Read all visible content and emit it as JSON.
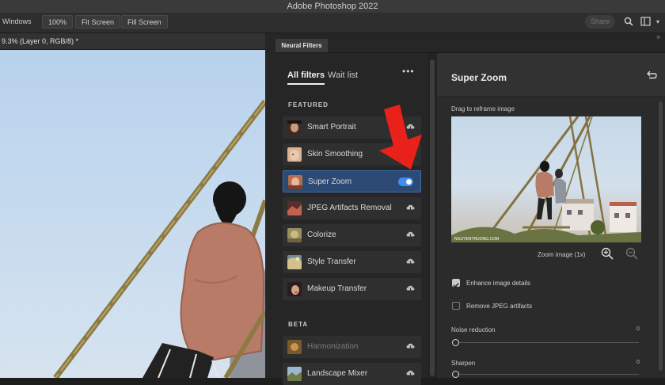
{
  "app": {
    "title": "Adobe Photoshop 2022"
  },
  "options_bar": {
    "windows_label": "Windows",
    "zoom_label": "100%",
    "fit_screen_label": "Fit Screen",
    "fill_screen_label": "Fill Screen",
    "share_label": "Share"
  },
  "document": {
    "tab_title": "9.3% (Layer 0, RGB/8) *"
  },
  "neural_filters": {
    "panel_tab": "Neural Filters",
    "tabs": {
      "all": "All filters",
      "wait": "Wait list"
    },
    "sections": {
      "featured": "FEATURED",
      "beta": "BETA"
    },
    "featured": [
      {
        "label": "Smart Portrait"
      },
      {
        "label": "Skin Smoothing"
      },
      {
        "label": "Super Zoom"
      },
      {
        "label": "JPEG Artifacts Removal"
      },
      {
        "label": "Colorize"
      },
      {
        "label": "Style Transfer"
      },
      {
        "label": "Makeup Transfer"
      }
    ],
    "beta": [
      {
        "label": "Harmonization"
      },
      {
        "label": "Landscape Mixer"
      }
    ],
    "selected_filter": "Super Zoom",
    "selected_enabled": true
  },
  "settings": {
    "title": "Super Zoom",
    "drag_hint": "Drag to reframe image",
    "zoom_label": "Zoom image (1x)",
    "enhance_label": "Enhance image details",
    "enhance_checked": true,
    "remove_jpeg_label": "Remove JPEG artifacts",
    "remove_jpeg_checked": false,
    "noise_label": "Noise reduction",
    "noise_value": "0",
    "sharpen_label": "Sharpen",
    "sharpen_value": "0"
  },
  "colors": {
    "accent": "#3d8ef0",
    "selected_bg": "#2c4a73",
    "annotation_arrow": "#e8221b"
  },
  "icons": [
    "search-icon",
    "workspace-icon",
    "more-icon",
    "cloud-download-icon",
    "reset-icon",
    "zoom-in-icon",
    "zoom-out-icon"
  ]
}
